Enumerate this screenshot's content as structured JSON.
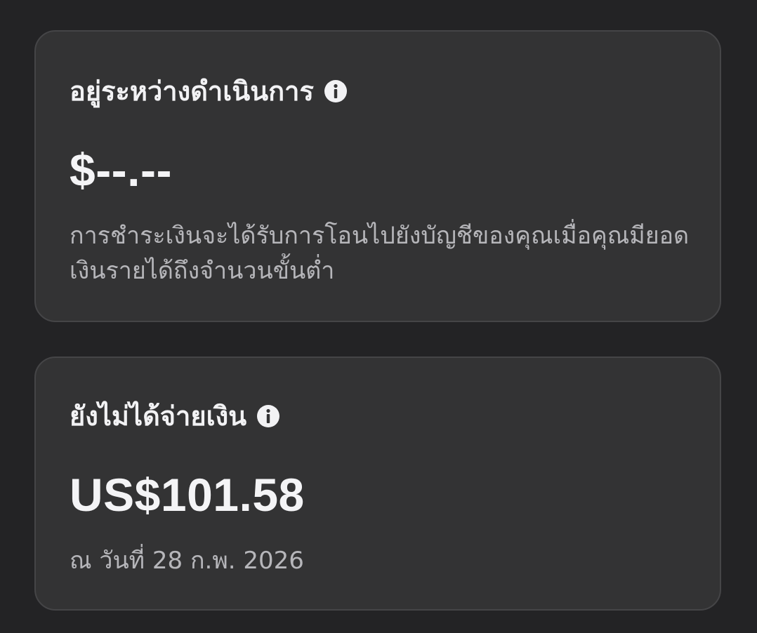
{
  "pending": {
    "title": "อยู่ระหว่างดำเนินการ",
    "info_icon": "info-icon",
    "amount": "$--.--",
    "description": "การชำระเงินจะได้รับการโอนไปยังบัญชีของคุณเมื่อคุณมียอดเงินรายได้ถึงจำนวนขั้นต่ำ"
  },
  "unpaid": {
    "title": "ยังไม่ได้จ่ายเงิน",
    "info_icon": "info-icon",
    "amount": "US$101.58",
    "as_of": "ณ วันที่ 28 ก.พ. 2026"
  },
  "colors": {
    "background": "#232325",
    "card": "#333334",
    "card_border": "#454547",
    "title_text": "#f2f2f4",
    "secondary_text": "#b6b6ba"
  }
}
